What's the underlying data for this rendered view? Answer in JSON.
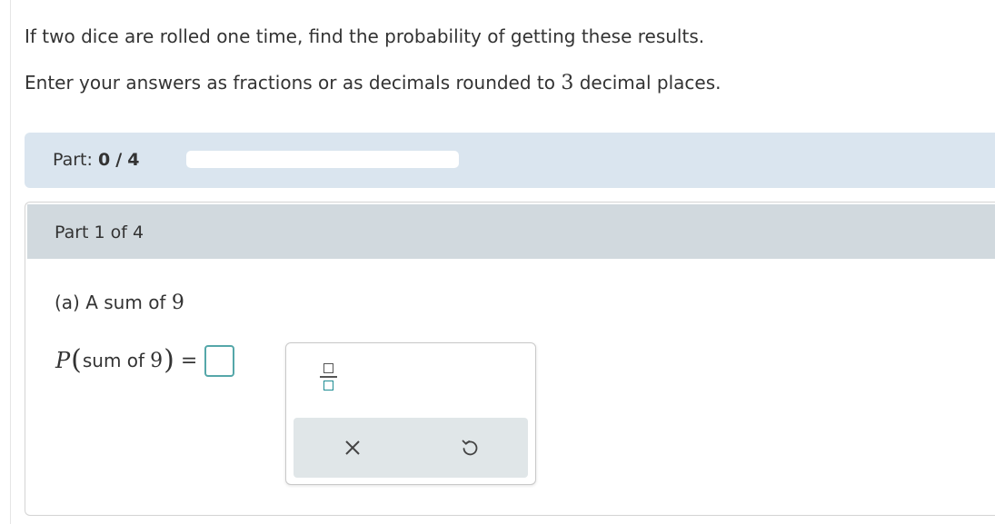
{
  "instructions": {
    "line1": "If two dice are rolled one time, find the probability of getting these results.",
    "line2_prefix": "Enter your answers as fractions or as decimals rounded to",
    "line2_number": "3",
    "line2_suffix": "decimal places."
  },
  "progress": {
    "label": "Part:",
    "completed": "0",
    "separator": "/",
    "total": "4",
    "fraction_complete": 0
  },
  "part": {
    "header": "Part 1 of 4",
    "question_prefix": "(a) A sum of",
    "question_number": "9",
    "equation": {
      "prob_symbol": "P",
      "open_paren": "(",
      "text": "sum of",
      "number": "9",
      "close_paren": ")",
      "equals": "=",
      "answer_value": ""
    }
  },
  "toolbox": {
    "fraction_icon": "fraction-template-icon",
    "clear_icon": "x-icon",
    "undo_icon": "undo-icon"
  },
  "colors": {
    "progress_bar_bg": "#dae5ef",
    "part_header_bg": "#d1d9de",
    "answer_box_border": "#55a7a9",
    "toolbox_footer_bg": "#e0e6e8"
  }
}
